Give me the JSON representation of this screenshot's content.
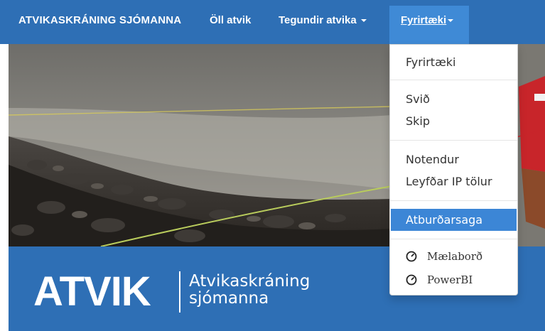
{
  "navbar": {
    "brand": "ATVIKASKRÁNING SJÓMANNA",
    "items": [
      {
        "label": "Öll atvik"
      },
      {
        "label": "Tegundir atvika"
      },
      {
        "label": "Fyrirtæki"
      }
    ]
  },
  "dropdown": {
    "items": [
      {
        "label": "Fyrirtæki"
      },
      {
        "label": "Svið"
      },
      {
        "label": "Skip"
      },
      {
        "label": "Notendur"
      },
      {
        "label": "Leyfðar IP tölur"
      },
      {
        "label": "Atburðarsaga"
      },
      {
        "label": "Mælaborð",
        "icon": "gauge-icon"
      },
      {
        "label": "PowerBI",
        "icon": "gauge-icon"
      }
    ]
  },
  "logo": {
    "wordmark": "ATVIK",
    "tagline_line1": "Atvikaskráning",
    "tagline_line2": "sjómanna"
  },
  "colors": {
    "navbar": "#2e6fb5",
    "active": "#3c86d6",
    "text": "#333333"
  }
}
